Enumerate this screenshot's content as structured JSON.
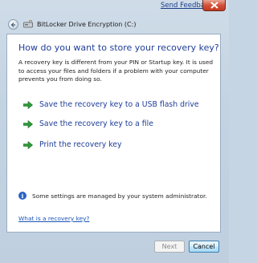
{
  "window": {
    "send_feedback": "Send Feedback",
    "title": "BitLocker Drive Encryption (C:)"
  },
  "content": {
    "heading": "How do you want to store your recovery key?",
    "description": "A recovery key is different from your PIN or Startup key. It is used to access your files and folders if a problem with your computer prevents you from doing so.",
    "options": [
      {
        "label": "Save the recovery key to a USB flash drive"
      },
      {
        "label": "Save the recovery key to a file"
      },
      {
        "label": "Print the recovery key"
      }
    ],
    "info_text": "Some settings are managed by your system administrator.",
    "help_link": "What is a recovery key?"
  },
  "footer": {
    "next_label": "Next",
    "cancel_label": "Cancel"
  },
  "colors": {
    "heading": "#1f3d99",
    "link": "#1a55b8",
    "arrow": "#2e9a3a"
  }
}
